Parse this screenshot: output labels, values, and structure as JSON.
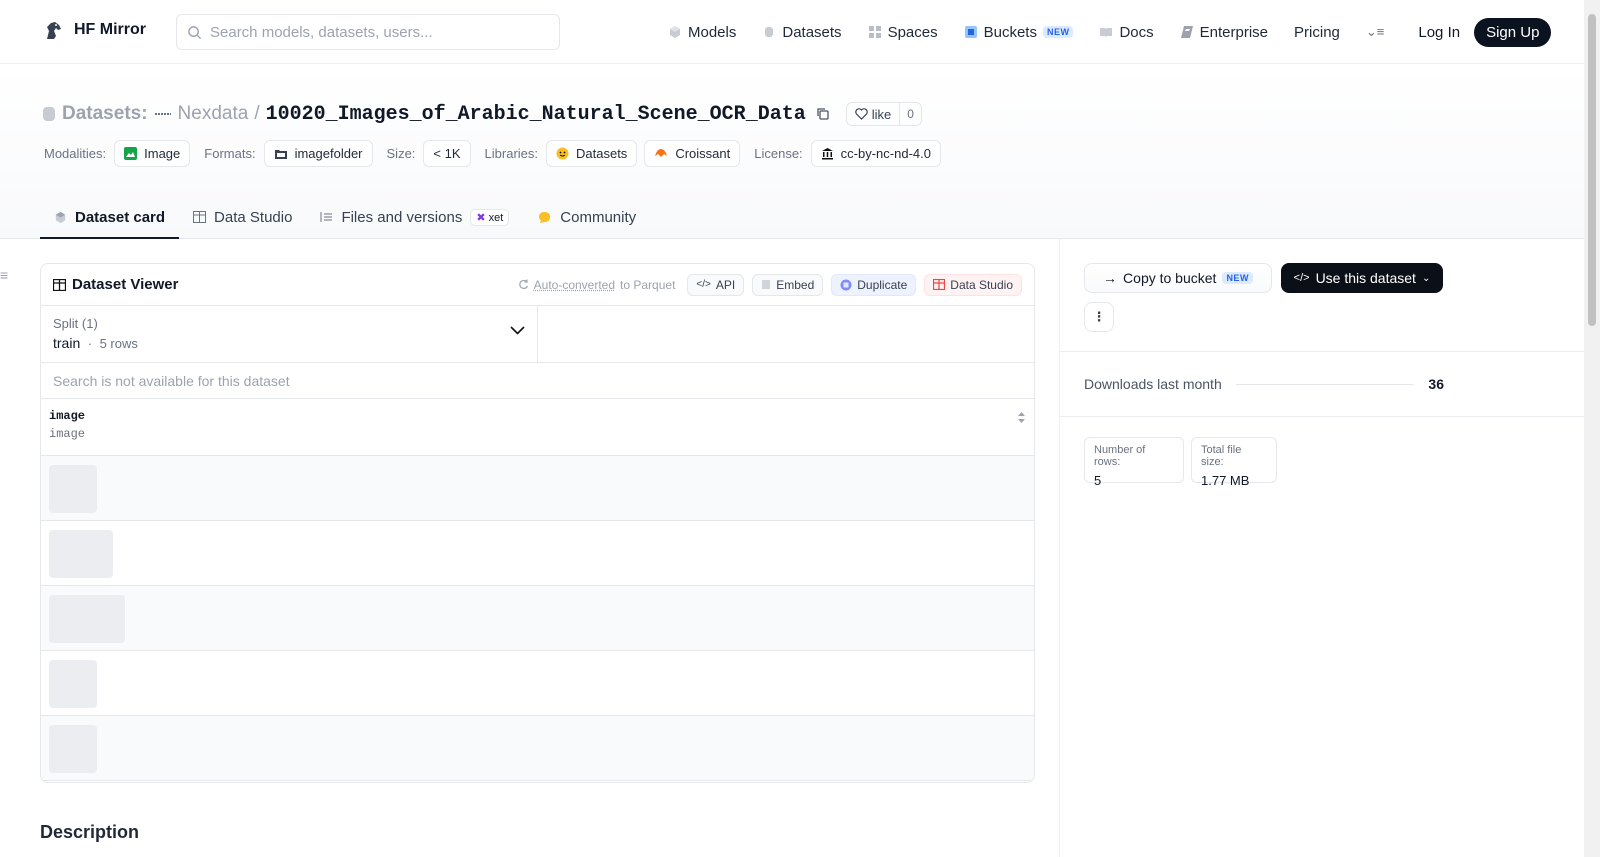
{
  "nav": {
    "brand": "HF Mirror",
    "search_placeholder": "Search models, datasets, users...",
    "links": [
      {
        "label": "Models",
        "icon": "cube-icon"
      },
      {
        "label": "Datasets",
        "icon": "database-icon"
      },
      {
        "label": "Spaces",
        "icon": "grid-icon"
      },
      {
        "label": "Buckets",
        "icon": "bucket-icon",
        "badge": "NEW"
      },
      {
        "label": "Docs",
        "icon": "book-icon"
      },
      {
        "label": "Enterprise",
        "icon": "enterprise-icon"
      },
      {
        "label": "Pricing",
        "icon": ""
      }
    ],
    "login": "Log In",
    "signup": "Sign Up"
  },
  "header": {
    "section": "Datasets:",
    "owner": "Nexdata",
    "separator": "/",
    "name": "10020_Images_of_Arabic_Natural_Scene_OCR_Data",
    "like_label": "like",
    "like_count": "0",
    "meta": {
      "modalities_label": "Modalities:",
      "modality": "Image",
      "formats_label": "Formats:",
      "format": "imagefolder",
      "size_label": "Size:",
      "size": "< 1K",
      "libraries_label": "Libraries:",
      "library1": "Datasets",
      "library2": "Croissant",
      "license_label": "License:",
      "license": "cc-by-nc-nd-4.0"
    },
    "tabs": [
      {
        "label": "Dataset card",
        "active": true
      },
      {
        "label": "Data Studio"
      },
      {
        "label": "Files and versions",
        "badge": "xet"
      },
      {
        "label": "Community"
      }
    ]
  },
  "viewer": {
    "title": "Dataset Viewer",
    "auto_link": "Auto-converted",
    "auto_rest": "to Parquet",
    "buttons": {
      "api": "API",
      "embed": "Embed",
      "duplicate": "Duplicate",
      "studio": "Data Studio"
    },
    "split_label": "Split (1)",
    "split_value": "train",
    "split_rows": "5 rows",
    "search_note": "Search is not available for this dataset",
    "column_name": "image",
    "column_type": "image",
    "rows": 5
  },
  "description_heading": "Description",
  "sidebar": {
    "copy_label": "Copy to bucket",
    "copy_badge": "NEW",
    "use_label": "Use this dataset",
    "downloads_label": "Downloads last month",
    "downloads_value": "36",
    "rows_label": "Number of rows:",
    "rows_value": "5",
    "size_label": "Total file size:",
    "size_value": "1.77 MB"
  },
  "colors": {
    "accent_dark": "#0b0f17",
    "border": "#e5e7eb",
    "muted": "#6b7280",
    "new_badge": "#2563eb"
  }
}
